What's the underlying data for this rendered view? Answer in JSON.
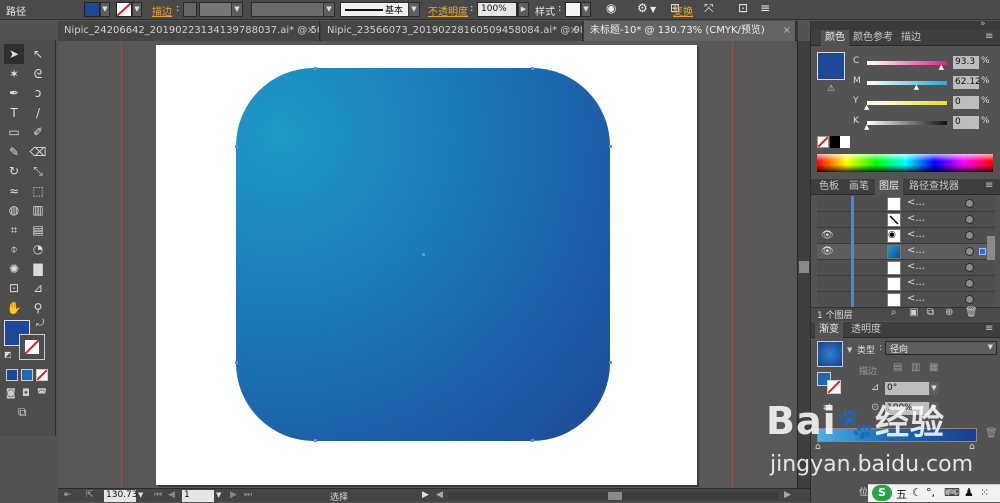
{
  "control_bar": {
    "object_type": "路径",
    "stroke_label": "描边",
    "brush_label": "基本",
    "opacity_label": "不透明度",
    "opacity_value": "100%",
    "style_label": "样式",
    "transform_label": "变换",
    "fill_color": "#1c4896"
  },
  "tabs": [
    {
      "label": "Nipic_24206642_20190223134139788037.ai* @ 50...",
      "close": "×"
    },
    {
      "label": "Nipic_23566073_20190228160509458084.ai* @ 98...",
      "close": "×"
    },
    {
      "label": "未标题-10* @ 130.73% (CMYK/预览)",
      "close": "×"
    }
  ],
  "tools": [
    {
      "icon": "selection-tool-icon",
      "glyph": "➤"
    },
    {
      "icon": "direct-selection-tool-icon",
      "glyph": "↖"
    },
    {
      "icon": "magic-wand-icon",
      "glyph": "✶"
    },
    {
      "icon": "lasso-icon",
      "glyph": "ᘓ"
    },
    {
      "icon": "pen-tool-icon",
      "glyph": "✒"
    },
    {
      "icon": "curvature-tool-icon",
      "glyph": "ↄ"
    },
    {
      "icon": "type-tool-icon",
      "glyph": "T"
    },
    {
      "icon": "line-tool-icon",
      "glyph": "/"
    },
    {
      "icon": "rectangle-tool-icon",
      "glyph": "▭"
    },
    {
      "icon": "paintbrush-icon",
      "glyph": "✐"
    },
    {
      "icon": "pencil-icon",
      "glyph": "✎"
    },
    {
      "icon": "eraser-icon",
      "glyph": "⌫"
    },
    {
      "icon": "rotate-tool-icon",
      "glyph": "↻"
    },
    {
      "icon": "scale-tool-icon",
      "glyph": "⤡"
    },
    {
      "icon": "warp-tool-icon",
      "glyph": "≈"
    },
    {
      "icon": "free-transform-icon",
      "glyph": "⬚"
    },
    {
      "icon": "shape-builder-icon",
      "glyph": "◍"
    },
    {
      "icon": "perspective-grid-icon",
      "glyph": "▥"
    },
    {
      "icon": "mesh-tool-icon",
      "glyph": "⌗"
    },
    {
      "icon": "gradient-tool-icon",
      "glyph": "▤"
    },
    {
      "icon": "eyedropper-icon",
      "glyph": "⌽"
    },
    {
      "icon": "blend-tool-icon",
      "glyph": "◔"
    },
    {
      "icon": "symbol-sprayer-icon",
      "glyph": "✺"
    },
    {
      "icon": "column-graph-icon",
      "glyph": "▇"
    },
    {
      "icon": "artboard-tool-icon",
      "glyph": "⊡"
    },
    {
      "icon": "slice-tool-icon",
      "glyph": "⊿"
    },
    {
      "icon": "hand-tool-icon",
      "glyph": "✋"
    },
    {
      "icon": "zoom-tool-icon",
      "glyph": "⚲"
    }
  ],
  "status_bar": {
    "zoom": "130.73",
    "artboard": "1",
    "tool_name": "选择"
  },
  "color_panel": {
    "tabs": [
      "颜色",
      "颜色参考",
      "描边"
    ],
    "channels": [
      {
        "name": "C",
        "value": "93.3",
        "level": 0.933,
        "color": "#e51d8a"
      },
      {
        "name": "M",
        "value": "62.12",
        "level": 0.621,
        "color": "#2aa7d8"
      },
      {
        "name": "Y",
        "value": "0",
        "level": 0,
        "color": "#e9df1f"
      },
      {
        "name": "K",
        "value": "0",
        "level": 0,
        "color": "#111111"
      }
    ]
  },
  "layers_panel": {
    "tabs": [
      "色板",
      "画笔",
      "图层",
      "路径查找器"
    ],
    "footer": "1 个图层",
    "rows": [
      {
        "visible": false,
        "dots": "<...",
        "thumb": "white"
      },
      {
        "visible": false,
        "dots": "<...",
        "thumb": "slash"
      },
      {
        "visible": true,
        "dots": "<...",
        "thumb": "eye"
      },
      {
        "visible": true,
        "dots": "<...",
        "thumb": "blue"
      },
      {
        "visible": false,
        "dots": "<...",
        "thumb": "white"
      },
      {
        "visible": false,
        "dots": "<...",
        "thumb": "white"
      },
      {
        "visible": false,
        "dots": "<...",
        "thumb": "white"
      }
    ]
  },
  "gradient_panel": {
    "tabs": [
      "渐变",
      "透明度"
    ],
    "type_label": "类型",
    "type_value": "径向",
    "stroke_label": "描边",
    "angle_value": "0°",
    "ratio_value": "100%",
    "location_label": "位置"
  },
  "watermark": {
    "brand": "Bai",
    "brand_suffix": "经验",
    "url": "jingyan.baidu.com"
  },
  "taskbar": {
    "ime": "五"
  }
}
